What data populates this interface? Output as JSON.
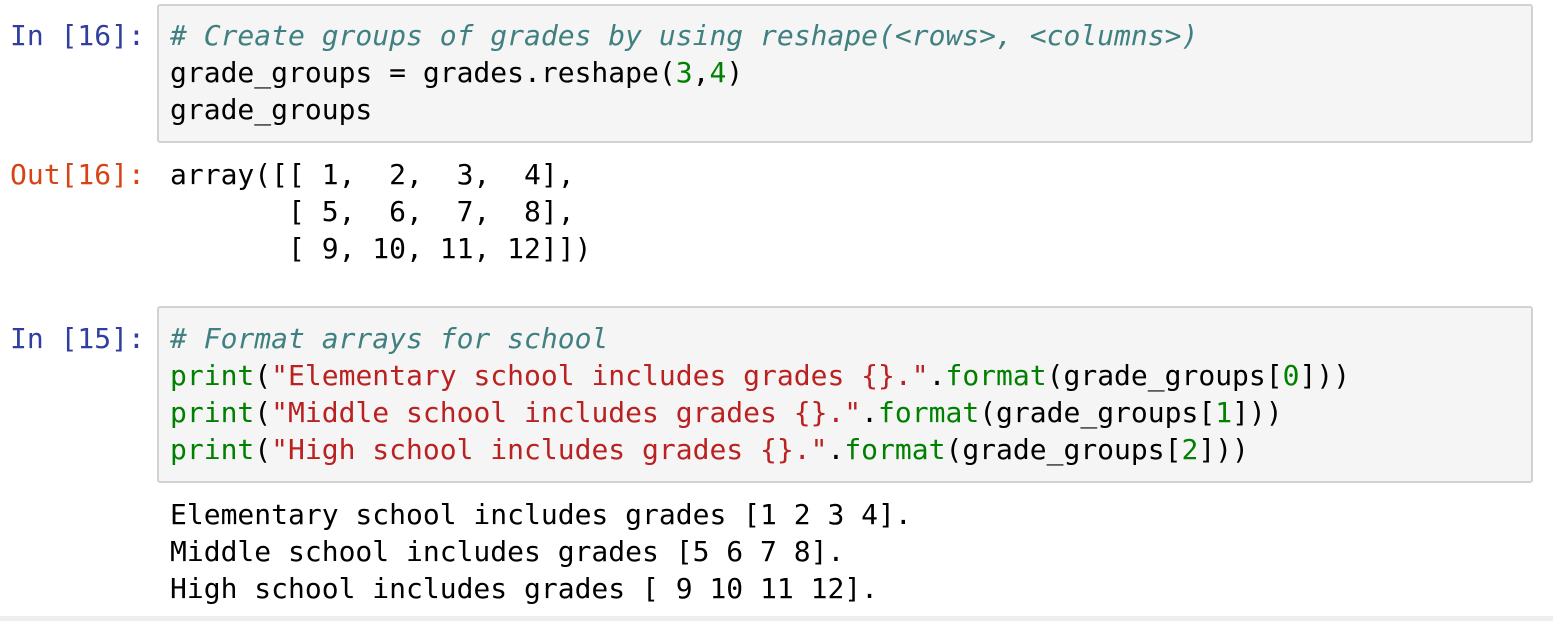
{
  "cell_16": {
    "in_prompt": "In [16]:",
    "out_prompt": "Out[16]:",
    "code_lines": [
      [
        {
          "t": "# Create groups of grades by using reshape(<rows>, <columns>)",
          "c": "comment"
        }
      ],
      [
        {
          "t": "grade_groups = grades.reshape(",
          "c": "plain"
        },
        {
          "t": "3",
          "c": "num"
        },
        {
          "t": ",",
          "c": "plain"
        },
        {
          "t": "4",
          "c": "num"
        },
        {
          "t": ")",
          "c": "plain"
        }
      ],
      [
        {
          "t": "grade_groups",
          "c": "plain"
        }
      ]
    ],
    "output_lines": [
      "array([[ 1,  2,  3,  4],",
      "       [ 5,  6,  7,  8],",
      "       [ 9, 10, 11, 12]])"
    ]
  },
  "cell_15": {
    "in_prompt": "In [15]:",
    "code_lines": [
      [
        {
          "t": "# Format arrays for school",
          "c": "comment"
        }
      ],
      [
        {
          "t": "print",
          "c": "builtin"
        },
        {
          "t": "(",
          "c": "plain"
        },
        {
          "t": "\"Elementary school includes grades {}.\"",
          "c": "str"
        },
        {
          "t": ".",
          "c": "plain"
        },
        {
          "t": "format",
          "c": "builtin"
        },
        {
          "t": "(grade_groups[",
          "c": "plain"
        },
        {
          "t": "0",
          "c": "num"
        },
        {
          "t": "]))",
          "c": "plain"
        }
      ],
      [
        {
          "t": "print",
          "c": "builtin"
        },
        {
          "t": "(",
          "c": "plain"
        },
        {
          "t": "\"Middle school includes grades {}.\"",
          "c": "str"
        },
        {
          "t": ".",
          "c": "plain"
        },
        {
          "t": "format",
          "c": "builtin"
        },
        {
          "t": "(grade_groups[",
          "c": "plain"
        },
        {
          "t": "1",
          "c": "num"
        },
        {
          "t": "]))",
          "c": "plain"
        }
      ],
      [
        {
          "t": "print",
          "c": "builtin"
        },
        {
          "t": "(",
          "c": "plain"
        },
        {
          "t": "\"High school includes grades {}.\"",
          "c": "str"
        },
        {
          "t": ".",
          "c": "plain"
        },
        {
          "t": "format",
          "c": "builtin"
        },
        {
          "t": "(grade_groups[",
          "c": "plain"
        },
        {
          "t": "2",
          "c": "num"
        },
        {
          "t": "]))",
          "c": "plain"
        }
      ]
    ],
    "output_lines": [
      "Elementary school includes grades [1 2 3 4].",
      "Middle school includes grades [5 6 7 8].",
      "High school includes grades [ 9 10 11 12]."
    ]
  }
}
